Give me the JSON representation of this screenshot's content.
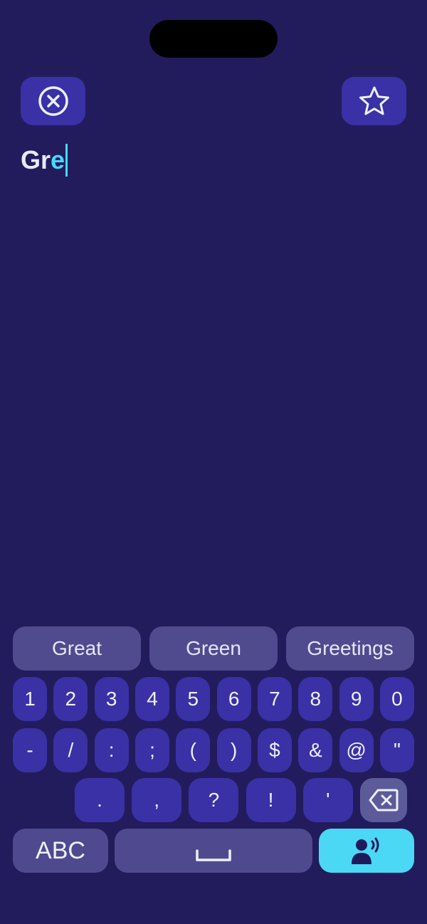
{
  "colors": {
    "background": "#221c5c",
    "key": "#3a31a6",
    "suggestion": "#504b8f",
    "accent": "#4ad8f5",
    "text": "#eef0ff"
  },
  "toolbar": {
    "clear_icon": "close-circle-icon",
    "favorite_icon": "star-icon"
  },
  "text_field": {
    "typed": "Gr",
    "active": "e"
  },
  "suggestions": [
    "Great",
    "Green",
    "Greetings"
  ],
  "keyboard": {
    "numbers": [
      "1",
      "2",
      "3",
      "4",
      "5",
      "6",
      "7",
      "8",
      "9",
      "0"
    ],
    "symbols": [
      "-",
      "/",
      ":",
      ";",
      "(",
      ")",
      "$",
      "&",
      "@",
      "\""
    ],
    "punctuation": [
      ".",
      ",",
      "?",
      "!",
      "'"
    ],
    "delete_icon": "backspace-icon",
    "abc_label": "ABC",
    "space_icon": "space-icon",
    "speak_icon": "speak-person-icon"
  }
}
